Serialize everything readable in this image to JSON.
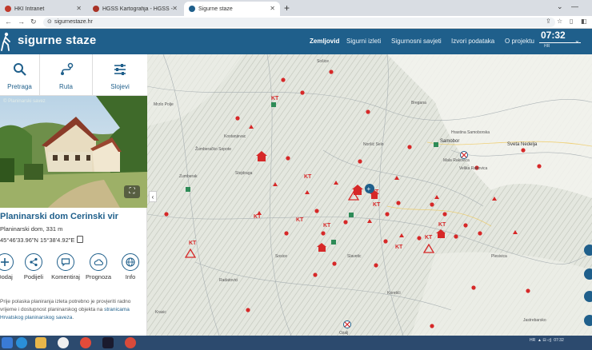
{
  "browser": {
    "tabs": [
      {
        "title": "HKI Intranet",
        "active": false
      },
      {
        "title": "HGSS Kartografija - HGSS - Hrvat",
        "active": false
      },
      {
        "title": "Sigurne staze",
        "active": true
      }
    ],
    "url": "sigurnestaze.hr"
  },
  "site": {
    "title": "sigurne staze",
    "nav": [
      {
        "label": "Zemljovid",
        "active": true
      },
      {
        "label": "Sigurni izleti",
        "active": false
      },
      {
        "label": "Sigurnosni savjeti",
        "active": false
      },
      {
        "label": "Izvori podataka",
        "active": false
      },
      {
        "label": "O projektu",
        "active": false
      }
    ],
    "clock": "07:32",
    "clock_sub": "HR"
  },
  "sidebar": {
    "tools": [
      {
        "label": "Pretraga",
        "icon": "search-icon"
      },
      {
        "label": "Ruta",
        "icon": "route-icon"
      },
      {
        "label": "Slojevi",
        "icon": "layers-icon"
      }
    ],
    "photo_credit": "© Planinarski savez",
    "place": {
      "title": "Planinarski dom Cerinski vir",
      "subtitle": "Planinarski dom, 331 m",
      "coords": "45°46'33.96\"N 15°38'4.92\"E"
    },
    "actions": [
      {
        "label": "Dodaj",
        "icon": "add-icon"
      },
      {
        "label": "Podijeli",
        "icon": "share-icon"
      },
      {
        "label": "Komentiraj",
        "icon": "comment-icon"
      },
      {
        "label": "Prognoza",
        "icon": "cloud-icon"
      },
      {
        "label": "Info",
        "icon": "globe-icon"
      }
    ],
    "note_text": "Prije polaska planiranja izleta potrebno je provjeriti radno vrijeme i dostupnost planinarskog objekta na ",
    "note_link": "stranicama Hrvatskog planinarskog saveza",
    "note_end": "."
  },
  "map": {
    "labels": [
      "Samobor",
      "Sveta Nedelja",
      "Hrastina Samoborska",
      "Mala Rakovica",
      "Velika Rakovica",
      "Zumberak",
      "Stojdraga",
      "Sosice",
      "Radatovici",
      "Slavetic",
      "Plesivica",
      "Jastrebarsko",
      "Krasic",
      "Ozalj",
      "Bregana",
      "Noršić Selo",
      "Sošice",
      "Kostanjevac",
      "Žumberačko Sopote",
      "Koretići",
      "Mrzlo Polje"
    ]
  },
  "taskbar": {
    "tray_time": "07:32",
    "tray_lang": "HR"
  },
  "colors": {
    "header": "#1f5f8b",
    "accent": "#1f5f8b",
    "marker_red": "#d62828",
    "taskbar": "#2c4a6e"
  }
}
